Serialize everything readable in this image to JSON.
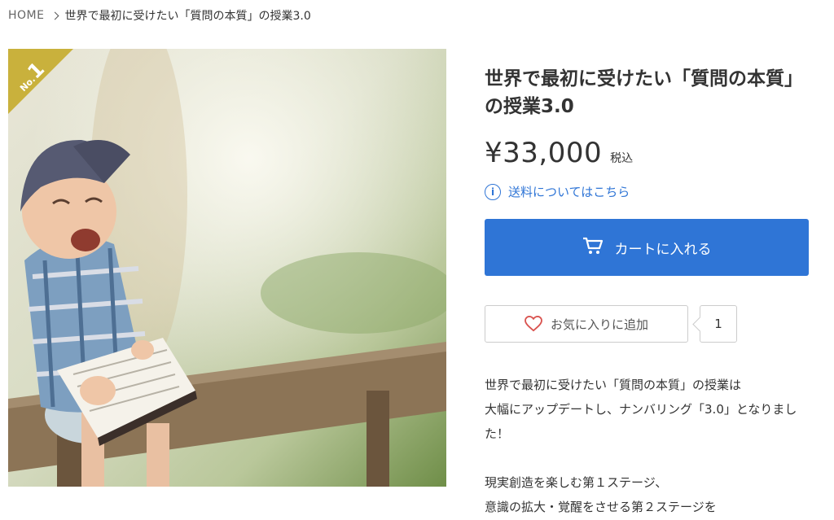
{
  "breadcrumb": {
    "home": "HOME",
    "current": "世界で最初に受けたい「質問の本質」の授業3.0"
  },
  "badge": {
    "prefix": "No.",
    "number": "1"
  },
  "product": {
    "title": "世界で最初に受けたい「質問の本質」の授業3.0",
    "price": "¥33,000",
    "tax_label": "税込",
    "shipping_link": "送料についてはこちら",
    "cart_label": "カートに入れる",
    "favorite_label": "お気に入りに追加",
    "favorite_count": "1"
  },
  "description": {
    "paragraph1": [
      "世界で最初に受けたい「質問の本質」の授業は",
      "大幅にアップデートし、ナンバリング「3.0」となりまし",
      "た！"
    ],
    "paragraph2": [
      "現実創造を楽しむ第１ステージ、",
      "意識の拡大・覚醒をさせる第２ステージを"
    ]
  },
  "colors": {
    "accent": "#2f75d6",
    "badge": "#c9b13c",
    "heart": "#d9534f"
  },
  "icons": {
    "info": "info-icon",
    "cart": "cart-icon",
    "heart": "heart-icon",
    "chevron": "chevron-right-icon"
  }
}
